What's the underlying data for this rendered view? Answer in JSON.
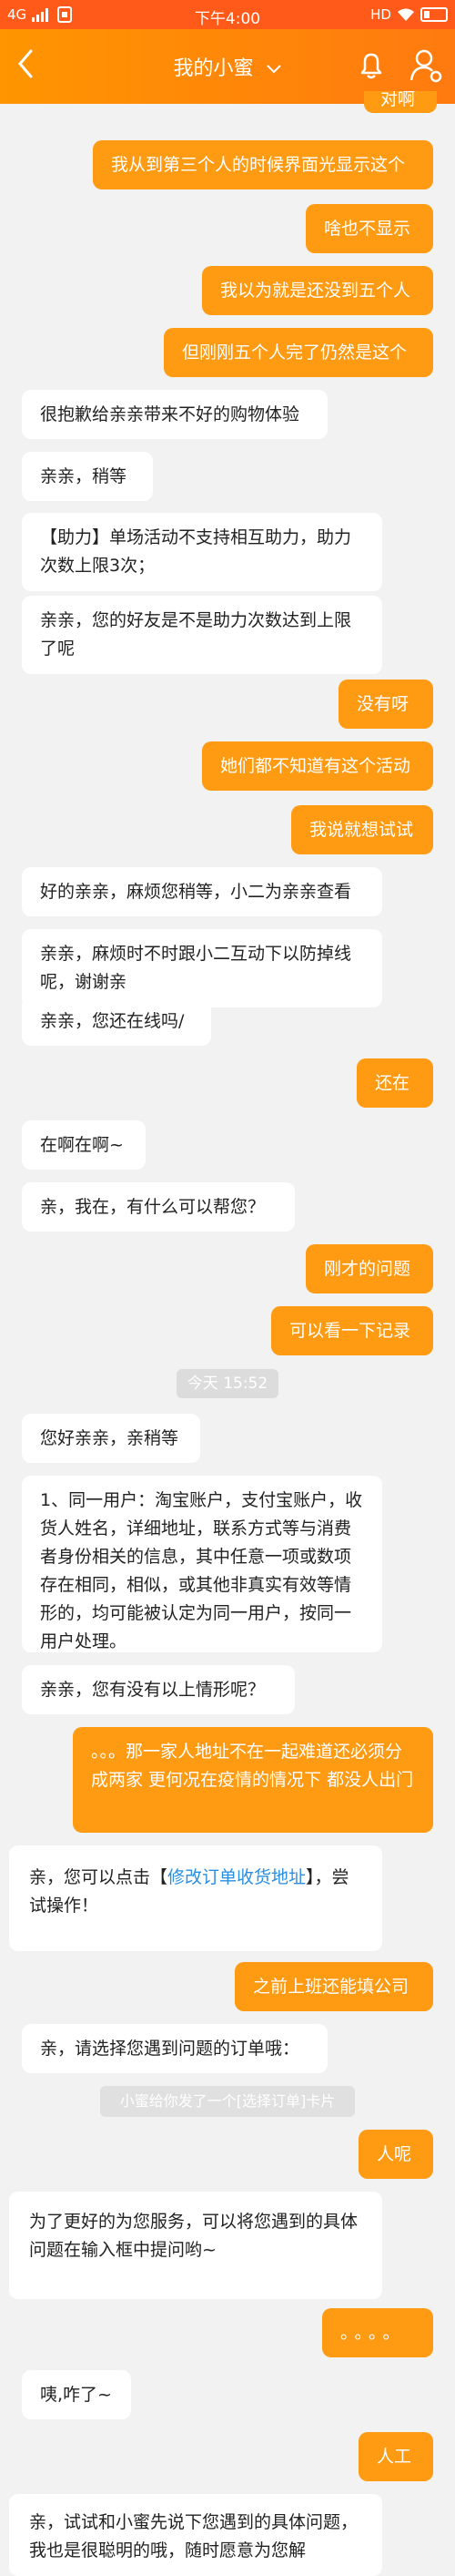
{
  "status": {
    "network": "4G",
    "time": "下午4:00",
    "hd": "HD"
  },
  "nav": {
    "title": "我的小蜜",
    "back_icon": "chevron-left-icon",
    "bell_icon": "bell-icon",
    "user_icon": "user-settings-icon"
  },
  "colors": {
    "status_bar": "#ff5a1a",
    "nav_bar": "#ff8a10",
    "right_bubble": "#ff9a13",
    "left_bubble": "#ffffff",
    "background": "#f2f2f2",
    "link": "#2b8ee0"
  },
  "messages": [
    {
      "side": "right",
      "text": "对啊"
    },
    {
      "side": "right",
      "text": "我从到第三个人的时候界面光显示这个"
    },
    {
      "side": "right",
      "text": "啥也不显示"
    },
    {
      "side": "right",
      "text": "我以为就是还没到五个人"
    },
    {
      "side": "right",
      "text": "但刚刚五个人完了仍然是这个"
    },
    {
      "side": "left",
      "text": "很抱歉给亲亲带来不好的购物体验"
    },
    {
      "side": "left",
      "text": "亲亲，稍等"
    },
    {
      "side": "left",
      "text": "【助力】单场活动不支持相互助力，助力次数上限3次；"
    },
    {
      "side": "left",
      "text": "亲亲，您的好友是不是助力次数达到上限了呢"
    },
    {
      "side": "right",
      "text": "没有呀"
    },
    {
      "side": "right",
      "text": "她们都不知道有这个活动"
    },
    {
      "side": "right",
      "text": "我说就想试试"
    },
    {
      "side": "left",
      "text": "好的亲亲，麻烦您稍等，小二为亲亲查看"
    },
    {
      "side": "left",
      "text": "亲亲，麻烦时不时跟小二互动下以防掉线呢，谢谢亲"
    },
    {
      "side": "left",
      "text": "亲亲，您还在线吗/"
    },
    {
      "side": "right",
      "text": "还在"
    },
    {
      "side": "left",
      "text": "在啊在啊~"
    },
    {
      "side": "left",
      "text": "亲，我在，有什么可以帮您？"
    },
    {
      "side": "right",
      "text": "刚才的问题"
    },
    {
      "side": "right",
      "text": "可以看一下记录"
    },
    {
      "side": "left",
      "text": "您好亲亲，亲稍等"
    },
    {
      "side": "left",
      "text": "1、同一用户：淘宝账户，支付宝账户，收货人姓名，详细地址，联系方式等与消费者身份相关的信息，其中任意一项或数项存在相同，相似，或其他非真实有效等情形的，均可能被认定为同一用户，按同一用户处理。"
    },
    {
      "side": "left",
      "text": "亲亲，您有没有以上情形呢？"
    },
    {
      "side": "right",
      "text": "。。。那一家人地址不在一起难道还必须分成两家 更何况在疫情的情况下 都没人出门"
    },
    {
      "side": "left",
      "text_before": "亲，您可以点击【",
      "link": "修改订单收货地址",
      "text_after": "】，尝试操作！"
    },
    {
      "side": "right",
      "text": "之前上班还能填公司"
    },
    {
      "side": "left",
      "text": "亲，请选择您遇到问题的订单哦："
    },
    {
      "side": "right",
      "text": "人呢"
    },
    {
      "side": "left",
      "text": "为了更好的为您服务，可以将您遇到的具体问题在输入框中提问哟~"
    },
    {
      "side": "right",
      "text": "。。。。"
    },
    {
      "side": "left",
      "text": "咦,咋了~"
    },
    {
      "side": "right",
      "text": "人工"
    },
    {
      "side": "left",
      "text": "亲，试试和小蜜先说下您遇到的具体问题，我也是很聪明的哦，随时愿意为您解"
    }
  ],
  "time_divider": "今天 15:52",
  "card_notice": "小蜜给你发了一个[选择订单]卡片"
}
